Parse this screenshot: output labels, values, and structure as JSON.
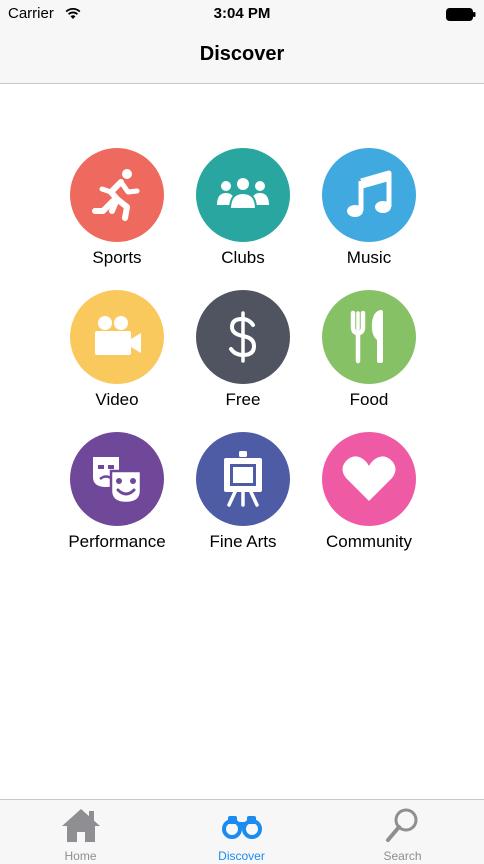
{
  "status_bar": {
    "carrier": "Carrier",
    "time": "3:04 PM"
  },
  "nav_bar": {
    "title": "Discover"
  },
  "categories": [
    {
      "label": "Sports",
      "icon": "running-person-icon",
      "color": "#ef6a5e"
    },
    {
      "label": "Clubs",
      "icon": "group-people-icon",
      "color": "#28a69f"
    },
    {
      "label": "Music",
      "icon": "music-note-icon",
      "color": "#3fa9e0"
    },
    {
      "label": "Video",
      "icon": "video-camera-icon",
      "color": "#fac95e"
    },
    {
      "label": "Free",
      "icon": "dollar-sign-icon",
      "color": "#4f5460"
    },
    {
      "label": "Food",
      "icon": "fork-knife-icon",
      "color": "#86c166"
    },
    {
      "label": "Performance",
      "icon": "theater-masks-icon",
      "color": "#6f489a"
    },
    {
      "label": "Fine Arts",
      "icon": "easel-painting-icon",
      "color": "#4e5ba5"
    },
    {
      "label": "Community",
      "icon": "heart-icon",
      "color": "#ee5aa3"
    }
  ],
  "tab_bar": {
    "items": [
      {
        "label": "Home",
        "icon": "home-icon",
        "active": false
      },
      {
        "label": "Discover",
        "icon": "binoculars-icon",
        "active": true
      },
      {
        "label": "Search",
        "icon": "magnifier-icon",
        "active": false
      }
    ],
    "active_color": "#1a8cf0",
    "inactive_color": "#8e8e93"
  }
}
